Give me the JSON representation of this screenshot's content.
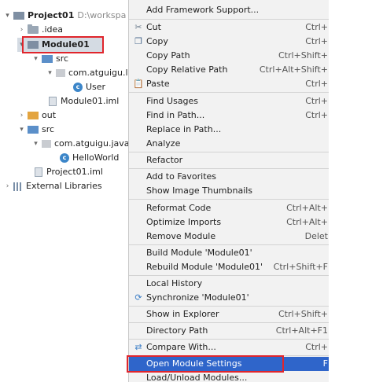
{
  "tree": {
    "project": {
      "name": "Project01",
      "path": "D:\\workspa"
    },
    "items": [
      {
        "label": ".idea"
      },
      {
        "label": "Module01"
      },
      {
        "label": "src"
      },
      {
        "label": "com.atguigu.l"
      },
      {
        "label": "User",
        "badge": "c"
      },
      {
        "label": "Module01.iml"
      },
      {
        "label": "out"
      },
      {
        "label": "src"
      },
      {
        "label": "com.atguigu.java"
      },
      {
        "label": "HelloWorld",
        "badge": "c"
      },
      {
        "label": "Project01.iml"
      },
      {
        "label": "External Libraries"
      }
    ]
  },
  "menu": {
    "items": [
      {
        "label": "Add Framework Support...",
        "shortcut": ""
      },
      {
        "label": "Cut",
        "shortcut": "Ctrl+",
        "icon": "cut-icon"
      },
      {
        "label": "Copy",
        "shortcut": "Ctrl+",
        "icon": "copy-icon"
      },
      {
        "label": "Copy Path",
        "shortcut": "Ctrl+Shift+"
      },
      {
        "label": "Copy Relative Path",
        "shortcut": "Ctrl+Alt+Shift+"
      },
      {
        "label": "Paste",
        "shortcut": "Ctrl+",
        "icon": "paste-icon"
      },
      {
        "label": "Find Usages",
        "shortcut": "Ctrl+"
      },
      {
        "label": "Find in Path...",
        "shortcut": "Ctrl+"
      },
      {
        "label": "Replace in Path...",
        "shortcut": ""
      },
      {
        "label": "Analyze",
        "shortcut": ""
      },
      {
        "label": "Refactor",
        "shortcut": ""
      },
      {
        "label": "Add to Favorites",
        "shortcut": ""
      },
      {
        "label": "Show Image Thumbnails",
        "shortcut": ""
      },
      {
        "label": "Reformat Code",
        "shortcut": "Ctrl+Alt+"
      },
      {
        "label": "Optimize Imports",
        "shortcut": "Ctrl+Alt+"
      },
      {
        "label": "Remove Module",
        "shortcut": "Delet"
      },
      {
        "label": "Build Module 'Module01'",
        "shortcut": ""
      },
      {
        "label": "Rebuild Module 'Module01'",
        "shortcut": "Ctrl+Shift+F"
      },
      {
        "label": "Local History",
        "shortcut": ""
      },
      {
        "label": "Synchronize 'Module01'",
        "shortcut": "",
        "icon": "sync-icon"
      },
      {
        "label": "Show in Explorer",
        "shortcut": "Ctrl+Shift+"
      },
      {
        "label": "Directory Path",
        "shortcut": "Ctrl+Alt+F1"
      },
      {
        "label": "Compare With...",
        "shortcut": "Ctrl+",
        "icon": "compare-icon"
      },
      {
        "label": "Open Module Settings",
        "shortcut": "F"
      },
      {
        "label": "Load/Unload Modules...",
        "shortcut": ""
      }
    ]
  },
  "colors": {
    "selection": "#2f65ca",
    "highlight_box": "#e0252c"
  }
}
